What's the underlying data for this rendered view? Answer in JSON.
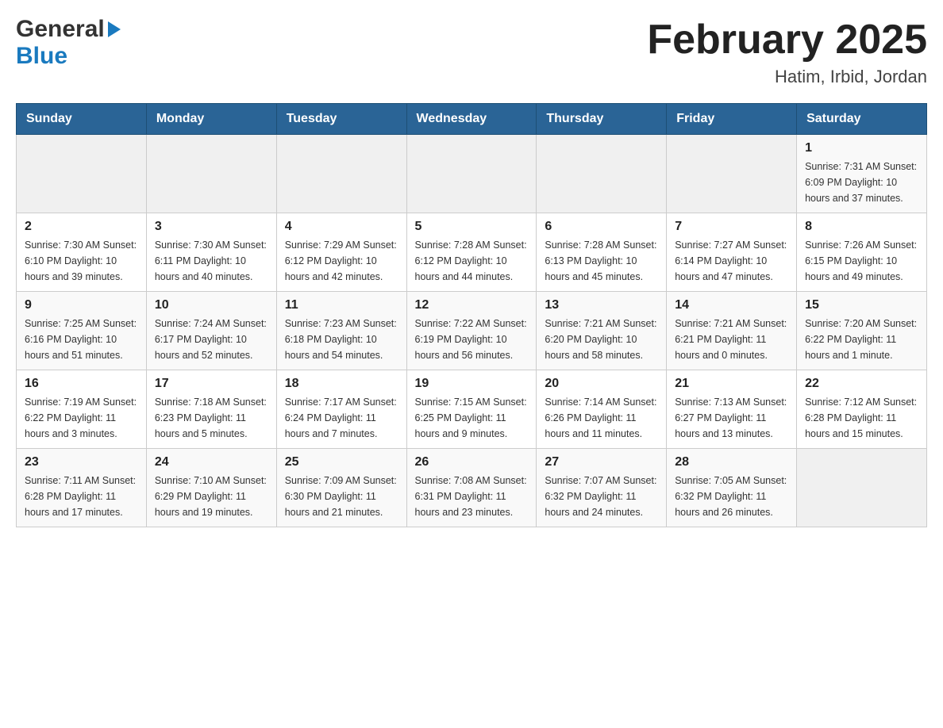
{
  "header": {
    "logo_general": "General",
    "logo_blue": "Blue",
    "title": "February 2025",
    "subtitle": "Hatim, Irbid, Jordan"
  },
  "calendar": {
    "days_of_week": [
      "Sunday",
      "Monday",
      "Tuesday",
      "Wednesday",
      "Thursday",
      "Friday",
      "Saturday"
    ],
    "weeks": [
      [
        {
          "day": "",
          "info": ""
        },
        {
          "day": "",
          "info": ""
        },
        {
          "day": "",
          "info": ""
        },
        {
          "day": "",
          "info": ""
        },
        {
          "day": "",
          "info": ""
        },
        {
          "day": "",
          "info": ""
        },
        {
          "day": "1",
          "info": "Sunrise: 7:31 AM\nSunset: 6:09 PM\nDaylight: 10 hours and 37 minutes."
        }
      ],
      [
        {
          "day": "2",
          "info": "Sunrise: 7:30 AM\nSunset: 6:10 PM\nDaylight: 10 hours and 39 minutes."
        },
        {
          "day": "3",
          "info": "Sunrise: 7:30 AM\nSunset: 6:11 PM\nDaylight: 10 hours and 40 minutes."
        },
        {
          "day": "4",
          "info": "Sunrise: 7:29 AM\nSunset: 6:12 PM\nDaylight: 10 hours and 42 minutes."
        },
        {
          "day": "5",
          "info": "Sunrise: 7:28 AM\nSunset: 6:12 PM\nDaylight: 10 hours and 44 minutes."
        },
        {
          "day": "6",
          "info": "Sunrise: 7:28 AM\nSunset: 6:13 PM\nDaylight: 10 hours and 45 minutes."
        },
        {
          "day": "7",
          "info": "Sunrise: 7:27 AM\nSunset: 6:14 PM\nDaylight: 10 hours and 47 minutes."
        },
        {
          "day": "8",
          "info": "Sunrise: 7:26 AM\nSunset: 6:15 PM\nDaylight: 10 hours and 49 minutes."
        }
      ],
      [
        {
          "day": "9",
          "info": "Sunrise: 7:25 AM\nSunset: 6:16 PM\nDaylight: 10 hours and 51 minutes."
        },
        {
          "day": "10",
          "info": "Sunrise: 7:24 AM\nSunset: 6:17 PM\nDaylight: 10 hours and 52 minutes."
        },
        {
          "day": "11",
          "info": "Sunrise: 7:23 AM\nSunset: 6:18 PM\nDaylight: 10 hours and 54 minutes."
        },
        {
          "day": "12",
          "info": "Sunrise: 7:22 AM\nSunset: 6:19 PM\nDaylight: 10 hours and 56 minutes."
        },
        {
          "day": "13",
          "info": "Sunrise: 7:21 AM\nSunset: 6:20 PM\nDaylight: 10 hours and 58 minutes."
        },
        {
          "day": "14",
          "info": "Sunrise: 7:21 AM\nSunset: 6:21 PM\nDaylight: 11 hours and 0 minutes."
        },
        {
          "day": "15",
          "info": "Sunrise: 7:20 AM\nSunset: 6:22 PM\nDaylight: 11 hours and 1 minute."
        }
      ],
      [
        {
          "day": "16",
          "info": "Sunrise: 7:19 AM\nSunset: 6:22 PM\nDaylight: 11 hours and 3 minutes."
        },
        {
          "day": "17",
          "info": "Sunrise: 7:18 AM\nSunset: 6:23 PM\nDaylight: 11 hours and 5 minutes."
        },
        {
          "day": "18",
          "info": "Sunrise: 7:17 AM\nSunset: 6:24 PM\nDaylight: 11 hours and 7 minutes."
        },
        {
          "day": "19",
          "info": "Sunrise: 7:15 AM\nSunset: 6:25 PM\nDaylight: 11 hours and 9 minutes."
        },
        {
          "day": "20",
          "info": "Sunrise: 7:14 AM\nSunset: 6:26 PM\nDaylight: 11 hours and 11 minutes."
        },
        {
          "day": "21",
          "info": "Sunrise: 7:13 AM\nSunset: 6:27 PM\nDaylight: 11 hours and 13 minutes."
        },
        {
          "day": "22",
          "info": "Sunrise: 7:12 AM\nSunset: 6:28 PM\nDaylight: 11 hours and 15 minutes."
        }
      ],
      [
        {
          "day": "23",
          "info": "Sunrise: 7:11 AM\nSunset: 6:28 PM\nDaylight: 11 hours and 17 minutes."
        },
        {
          "day": "24",
          "info": "Sunrise: 7:10 AM\nSunset: 6:29 PM\nDaylight: 11 hours and 19 minutes."
        },
        {
          "day": "25",
          "info": "Sunrise: 7:09 AM\nSunset: 6:30 PM\nDaylight: 11 hours and 21 minutes."
        },
        {
          "day": "26",
          "info": "Sunrise: 7:08 AM\nSunset: 6:31 PM\nDaylight: 11 hours and 23 minutes."
        },
        {
          "day": "27",
          "info": "Sunrise: 7:07 AM\nSunset: 6:32 PM\nDaylight: 11 hours and 24 minutes."
        },
        {
          "day": "28",
          "info": "Sunrise: 7:05 AM\nSunset: 6:32 PM\nDaylight: 11 hours and 26 minutes."
        },
        {
          "day": "",
          "info": ""
        }
      ]
    ]
  }
}
